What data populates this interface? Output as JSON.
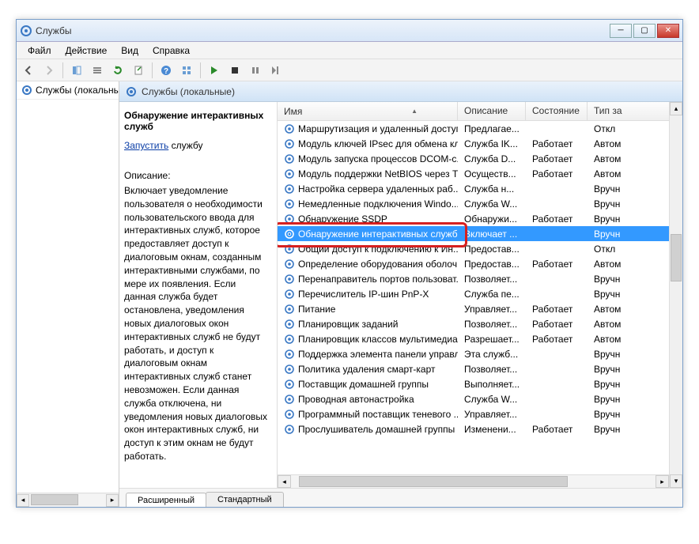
{
  "window": {
    "title": "Службы"
  },
  "menu": {
    "file": "Файл",
    "action": "Действие",
    "view": "Вид",
    "help": "Справка"
  },
  "leftnav": {
    "node": "Службы (локальны"
  },
  "pane": {
    "header": "Службы (локальные)"
  },
  "details": {
    "title": "Обнаружение интерактивных служб",
    "start_link": "Запустить",
    "start_suffix": " службу",
    "desc_label": "Описание:",
    "desc": "Включает уведомление пользователя о необходимости пользовательского ввода для интерактивных служб, которое предоставляет доступ к диалоговым окнам, созданным интерактивными службами, по мере их появления. Если данная служба будет остановлена, уведомления новых диалоговых окон интерактивных служб не будут работать, и доступ к диалоговым окнам интерактивных служб станет невозможен. Если данная служба отключена, ни уведомления новых диалоговых окон интерактивных служб, ни доступ к этим окнам не будут работать."
  },
  "columns": {
    "name": "Имя",
    "desc": "Описание",
    "state": "Состояние",
    "type": "Тип за"
  },
  "tabs": {
    "extended": "Расширенный",
    "standard": "Стандартный"
  },
  "services": [
    {
      "name": "Маршрутизация и удаленный доступ",
      "desc": "Предлагае...",
      "state": "",
      "type": "Откл"
    },
    {
      "name": "Модуль ключей IPsec для обмена кл...",
      "desc": "Служба IK...",
      "state": "Работает",
      "type": "Автом"
    },
    {
      "name": "Модуль запуска процессов DCOM-с...",
      "desc": "Служба D...",
      "state": "Работает",
      "type": "Автом"
    },
    {
      "name": "Модуль поддержки NetBIOS через T...",
      "desc": "Осуществ...",
      "state": "Работает",
      "type": "Автом"
    },
    {
      "name": "Настройка сервера удаленных раб...",
      "desc": "Служба н...",
      "state": "",
      "type": "Вручн"
    },
    {
      "name": "Немедленные подключения Windo...",
      "desc": "Служба W...",
      "state": "",
      "type": "Вручн"
    },
    {
      "name": "Обнаружение SSDP",
      "desc": "Обнаружи...",
      "state": "Работает",
      "type": "Вручн"
    },
    {
      "name": "Обнаружение интерактивных служб",
      "desc": "Включает ...",
      "state": "",
      "type": "Вручн",
      "selected": true
    },
    {
      "name": "Общий доступ к подключению к Ин...",
      "desc": "Предостав...",
      "state": "",
      "type": "Откл"
    },
    {
      "name": "Определение оборудования оболоч...",
      "desc": "Предостав...",
      "state": "Работает",
      "type": "Автом"
    },
    {
      "name": "Перенаправитель портов пользоват...",
      "desc": "Позволяет...",
      "state": "",
      "type": "Вручн"
    },
    {
      "name": "Перечислитель IP-шин PnP-X",
      "desc": "Служба пе...",
      "state": "",
      "type": "Вручн"
    },
    {
      "name": "Питание",
      "desc": "Управляет...",
      "state": "Работает",
      "type": "Автом"
    },
    {
      "name": "Планировщик заданий",
      "desc": "Позволяет...",
      "state": "Работает",
      "type": "Автом"
    },
    {
      "name": "Планировщик классов мультимедиа",
      "desc": "Разрешает...",
      "state": "Работает",
      "type": "Автом"
    },
    {
      "name": "Поддержка элемента панели управл...",
      "desc": "Эта служб...",
      "state": "",
      "type": "Вручн"
    },
    {
      "name": "Политика удаления смарт-карт",
      "desc": "Позволяет...",
      "state": "",
      "type": "Вручн"
    },
    {
      "name": "Поставщик домашней группы",
      "desc": "Выполняет...",
      "state": "",
      "type": "Вручн"
    },
    {
      "name": "Проводная автонастройка",
      "desc": "Служба W...",
      "state": "",
      "type": "Вручн"
    },
    {
      "name": "Программный поставщик теневого ...",
      "desc": "Управляет...",
      "state": "",
      "type": "Вручн"
    },
    {
      "name": "Прослушиватель домашней группы",
      "desc": "Изменени...",
      "state": "Работает",
      "type": "Вручн"
    }
  ]
}
